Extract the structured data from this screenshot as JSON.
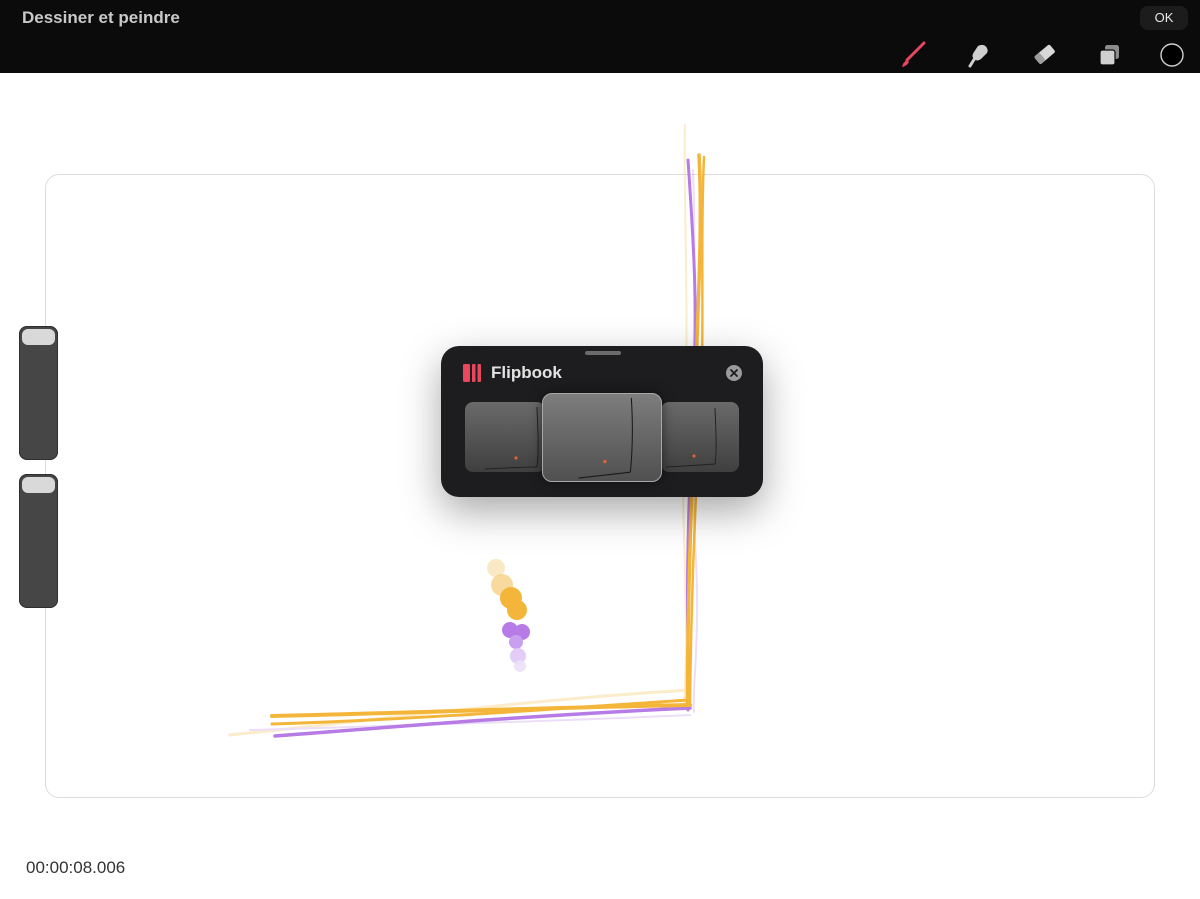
{
  "app": {
    "title": "Dessiner et peindre",
    "ok_label": "OK"
  },
  "toolbar": {
    "tools": [
      {
        "icon": "brush-icon",
        "active": true,
        "color": "#e84560"
      },
      {
        "icon": "smudge-icon",
        "active": false
      },
      {
        "icon": "eraser-icon",
        "active": false
      },
      {
        "icon": "layers-icon",
        "active": false
      },
      {
        "icon": "color-picker-icon",
        "active": false,
        "color": "#000000"
      }
    ]
  },
  "sidebar": {
    "sliders": [
      {
        "name": "brush-size",
        "level": 1.0
      },
      {
        "name": "opacity",
        "level": 1.0
      }
    ]
  },
  "canvas": {
    "stroke_colors": [
      "#f4b63a",
      "#b77be5"
    ]
  },
  "flipbook": {
    "title": "Flipbook",
    "logo_color": "#e8475e",
    "frames": 3,
    "selected_frame": 2
  },
  "status": {
    "timecode": "00:00:08.006"
  }
}
